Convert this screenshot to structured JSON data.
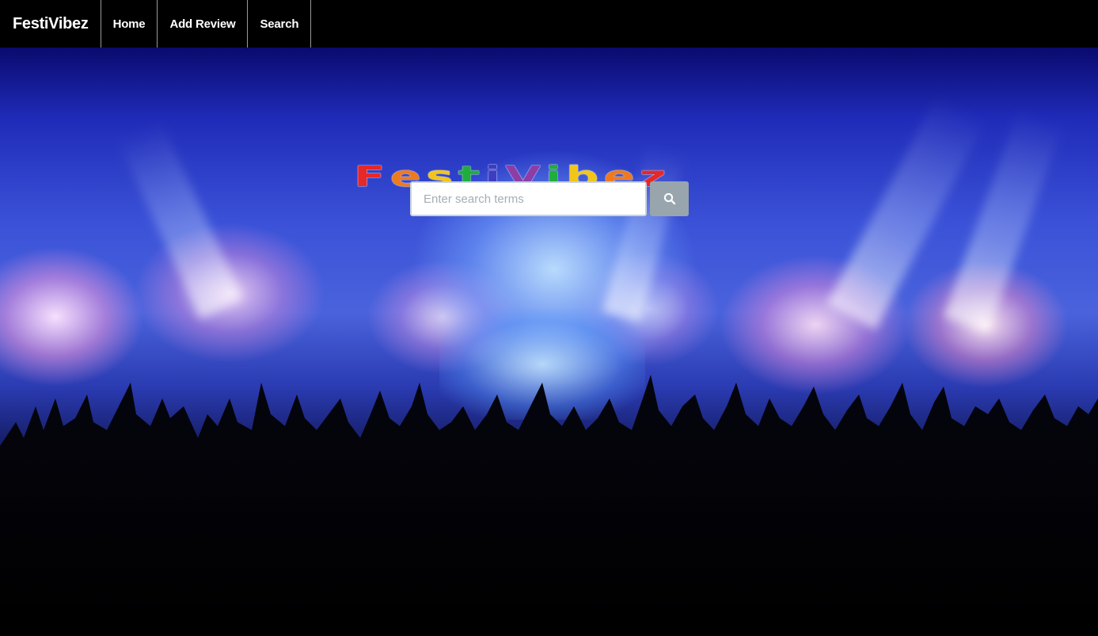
{
  "navbar": {
    "brand": "FestiVibez",
    "items": [
      {
        "label": "Home"
      },
      {
        "label": "Add Review"
      },
      {
        "label": "Search"
      }
    ]
  },
  "hero": {
    "logo_text": "FestiVibez",
    "logo_colors": [
      "#e62828",
      "#ee7a1e",
      "#f2c618",
      "#1fae3c",
      "#3d3dbf",
      "#8c3ea6",
      "#1fae3c",
      "#f2c618",
      "#ee7a1e"
    ],
    "background_image": "concert-crowd-stage-lights"
  },
  "search": {
    "placeholder": "Enter search terms",
    "value": "",
    "button_icon": "search-icon"
  }
}
